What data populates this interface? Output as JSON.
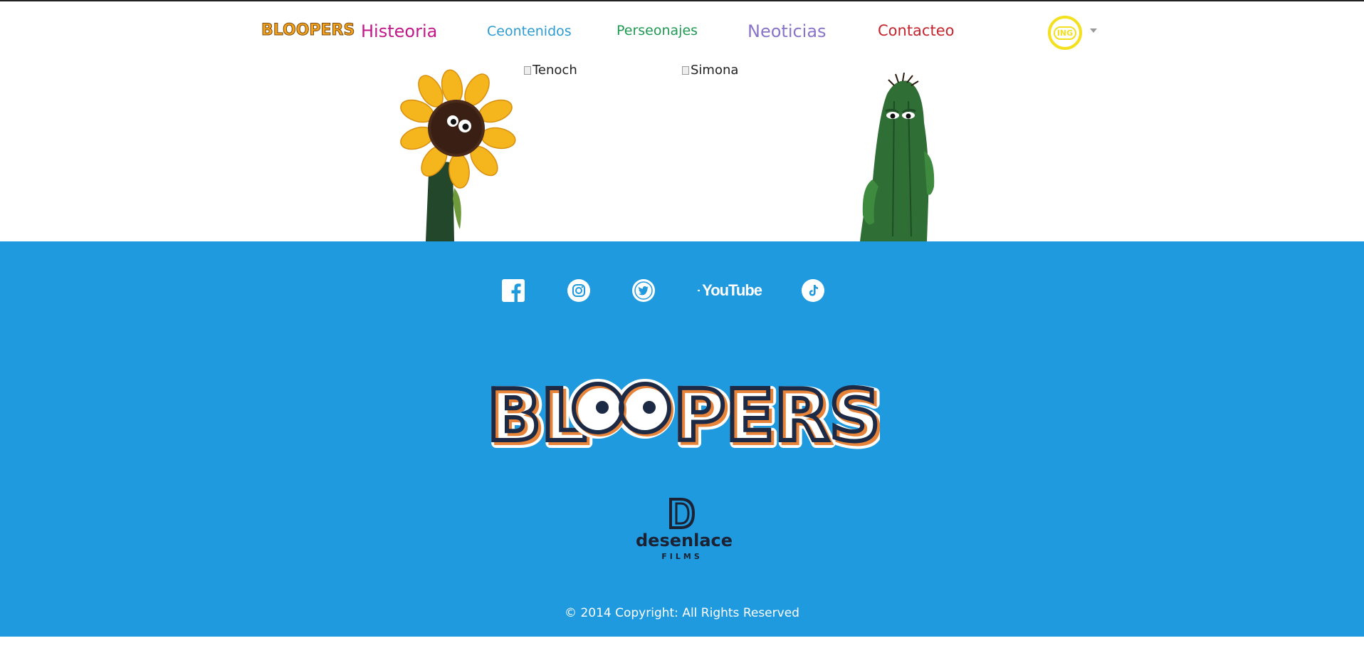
{
  "nav": {
    "brand": "BLOOPERS",
    "links": [
      {
        "label": "Histeoria",
        "color": "#c2188a"
      },
      {
        "label": "Ceontenidos",
        "color": "#2d9bd3"
      },
      {
        "label": "Perseonajes",
        "color": "#1f9a52"
      },
      {
        "label": "Neoticias",
        "color": "#8a74c9"
      },
      {
        "label": "Contacteo",
        "color": "#c4252f"
      }
    ],
    "language": "ING"
  },
  "hero": {
    "broken_images": [
      "Tenoch",
      "Simona"
    ]
  },
  "footer": {
    "background": "#209ade",
    "social": [
      {
        "icon": "facebook-icon"
      },
      {
        "icon": "instagram-icon"
      },
      {
        "icon": "twitter-icon"
      },
      {
        "icon": "youtube-icon",
        "label": "YouTube"
      },
      {
        "icon": "tiktok-icon"
      }
    ],
    "logo_text": "BLOOPERS",
    "producer": {
      "name": "desenlace",
      "sub": "FILMS"
    },
    "copyright": "© 2014 Copyright: All Rights Reserved"
  }
}
